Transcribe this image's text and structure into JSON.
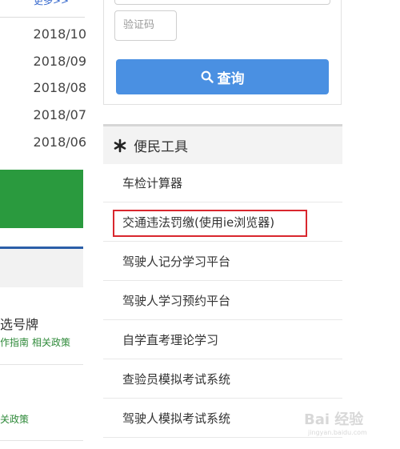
{
  "left": {
    "more_link": "更多>>",
    "dates": [
      "2018/10",
      "2018/09",
      "2018/08",
      "2018/07",
      "2018/06"
    ],
    "news": {
      "title": "选号牌",
      "link_guide": "作指南",
      "link_policy": "相关政策",
      "link_policy_2": "关政策"
    }
  },
  "query": {
    "captcha_placeholder": "验证码",
    "button_label": "查询"
  },
  "tools": {
    "header": "便民工具",
    "items": [
      {
        "label": "车检计算器"
      },
      {
        "label": "交通违法罚缴(使用ie浏览器)"
      },
      {
        "label": "驾驶人记分学习平台"
      },
      {
        "label": "驾驶人学习预约平台"
      },
      {
        "label": "自学直考理论学习"
      },
      {
        "label": "查验员模拟考试系统"
      },
      {
        "label": "驾驶人模拟考试系统"
      }
    ]
  },
  "watermark": {
    "brand": "Bai 经验",
    "url": "jingyan.baidu.com"
  },
  "colors": {
    "accent_blue": "#4a90e2",
    "green_block": "#2a9a3e",
    "highlight_red": "#d9272e",
    "nav_blue": "#2b5ea8"
  }
}
